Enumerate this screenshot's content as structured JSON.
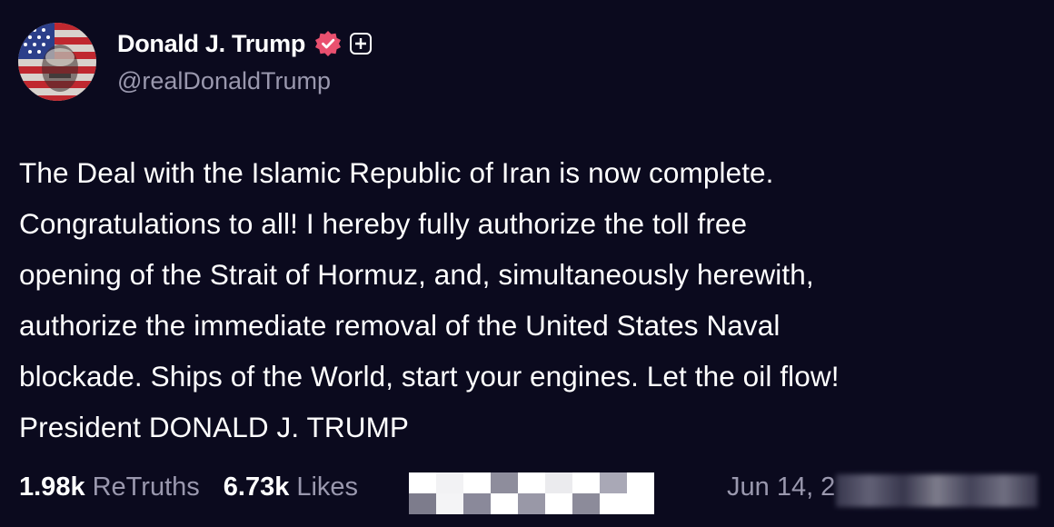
{
  "author": {
    "display_name": "Donald J. Trump",
    "handle": "@realDonaldTrump",
    "avatar_icon": "flag-portrait-avatar",
    "verified_icon": "verified-badge-icon",
    "verified_color": "#e9506f",
    "plus_icon": "plus-badge-icon"
  },
  "post": {
    "lines": [
      "The Deal with the Islamic Republic of Iran is now complete.",
      "Congratulations to all! I hereby fully authorize the toll free",
      "opening of the Strait of Hormuz, and, simultaneously herewith,",
      "authorize the immediate removal of the United States Naval",
      "blockade. Ships of the World, start your engines. Let the oil flow!",
      "President DONALD J. TRUMP"
    ]
  },
  "stats": {
    "retruths_count": "1.98k",
    "retruths_label": "ReTruths",
    "likes_count": "6.73k",
    "likes_label": "Likes"
  },
  "timestamp": {
    "visible_text": "Jun 14, 2"
  },
  "colors": {
    "background": "#0b0a1e",
    "text": "#ffffff",
    "muted": "#9a98ae"
  }
}
